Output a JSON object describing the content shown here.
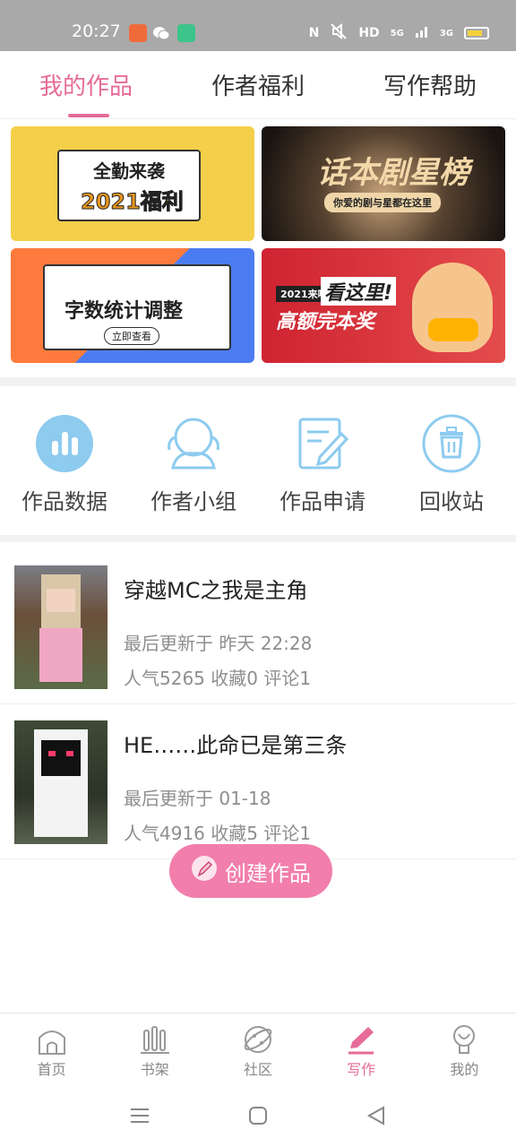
{
  "status_bar": {
    "time": "20:27",
    "network": "HD",
    "signal_labels": [
      "5G",
      "3G"
    ],
    "icons": [
      "app-icon-orange",
      "wechat-icon",
      "app-icon-green",
      "nfc-icon",
      "mute-icon",
      "signal-icon",
      "battery-icon"
    ]
  },
  "top_tabs": [
    {
      "label": "我的作品",
      "active": true
    },
    {
      "label": "作者福利",
      "active": false
    },
    {
      "label": "写作帮助",
      "active": false
    }
  ],
  "banners": [
    {
      "line1": "全勤来袭",
      "line2": "2021福利"
    },
    {
      "line1": "话本剧星榜",
      "line2": "你爱的剧与星都在这里"
    },
    {
      "line1": "字数统计调整",
      "button": "立即查看"
    },
    {
      "tag": "2021来啦",
      "line1": "看这里!",
      "line2": "高额完本奖"
    }
  ],
  "shortcuts": [
    {
      "label": "作品数据",
      "icon": "bar-chart-icon"
    },
    {
      "label": "作者小组",
      "icon": "group-icon"
    },
    {
      "label": "作品申请",
      "icon": "edit-document-icon"
    },
    {
      "label": "回收站",
      "icon": "trash-icon"
    }
  ],
  "works": [
    {
      "title": "穿越MC之我是主角",
      "updated": "最后更新于 昨天 22:28",
      "stats": "人气5265 收藏0 评论1"
    },
    {
      "title": "HE……此命已是第三条",
      "updated": "最后更新于 01-18",
      "stats": "人气4916 收藏5 评论1"
    }
  ],
  "create_button": {
    "label": "创建作品"
  },
  "bottom_nav": [
    {
      "label": "首页",
      "icon": "home-icon",
      "active": false
    },
    {
      "label": "书架",
      "icon": "bookshelf-icon",
      "active": false
    },
    {
      "label": "社区",
      "icon": "planet-icon",
      "active": false
    },
    {
      "label": "写作",
      "icon": "pen-icon",
      "active": true
    },
    {
      "label": "我的",
      "icon": "profile-icon",
      "active": false
    }
  ],
  "colors": {
    "accent": "#e66b98",
    "button": "#f17eab",
    "icon_blue": "#8dcbef"
  }
}
